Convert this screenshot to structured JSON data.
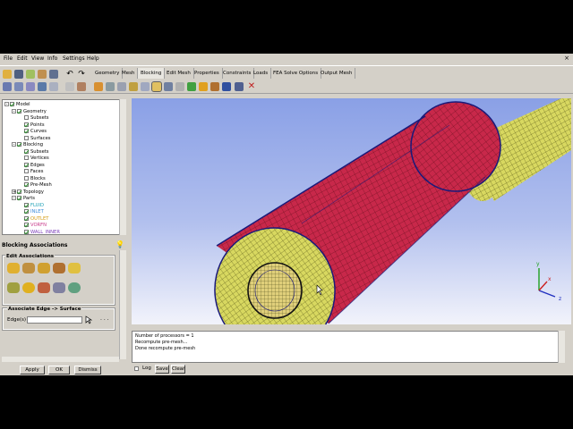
{
  "menu": [
    "File",
    "Edit",
    "View",
    "Info",
    "Settings",
    "Help"
  ],
  "tabs": [
    "Geometry",
    "Mesh",
    "Blocking",
    "Edit Mesh",
    "Properties",
    "Constraints",
    "Loads",
    "FEA Solve Options",
    "Output Mesh"
  ],
  "tree": [
    {
      "label": "Model",
      "indent": 0,
      "expander": "-",
      "checked": true,
      "color": "#000000"
    },
    {
      "label": "Geometry",
      "indent": 1,
      "expander": "-",
      "checked": true,
      "color": "#000000"
    },
    {
      "label": "Subsets",
      "indent": 2,
      "expander": "",
      "checked": false,
      "color": "#000000"
    },
    {
      "label": "Points",
      "indent": 2,
      "expander": "",
      "checked": true,
      "color": "#000000"
    },
    {
      "label": "Curves",
      "indent": 2,
      "expander": "",
      "checked": true,
      "color": "#000000"
    },
    {
      "label": "Surfaces",
      "indent": 2,
      "expander": "",
      "checked": false,
      "color": "#000000"
    },
    {
      "label": "Blocking",
      "indent": 1,
      "expander": "-",
      "checked": true,
      "color": "#000000"
    },
    {
      "label": "Subsets",
      "indent": 2,
      "expander": "",
      "checked": true,
      "color": "#000000"
    },
    {
      "label": "Vertices",
      "indent": 2,
      "expander": "",
      "checked": false,
      "color": "#000000"
    },
    {
      "label": "Edges",
      "indent": 2,
      "expander": "",
      "checked": true,
      "color": "#000000"
    },
    {
      "label": "Faces",
      "indent": 2,
      "expander": "",
      "checked": false,
      "color": "#000000"
    },
    {
      "label": "Blocks",
      "indent": 2,
      "expander": "",
      "checked": false,
      "color": "#000000"
    },
    {
      "label": "Pre-Mesh",
      "indent": 2,
      "expander": "",
      "checked": true,
      "color": "#000000"
    },
    {
      "label": "Topology",
      "indent": 1,
      "expander": "+",
      "checked": true,
      "color": "#000000"
    },
    {
      "label": "Parts",
      "indent": 1,
      "expander": "-",
      "checked": true,
      "color": "#000000"
    },
    {
      "label": "FLUID",
      "indent": 2,
      "expander": "",
      "checked": true,
      "color": "#1a9fb5"
    },
    {
      "label": "INLET",
      "indent": 2,
      "expander": "",
      "checked": true,
      "color": "#3a8ad8"
    },
    {
      "label": "OUTLET",
      "indent": 2,
      "expander": "",
      "checked": true,
      "color": "#d49a10"
    },
    {
      "label": "VORFN",
      "indent": 2,
      "expander": "",
      "checked": true,
      "color": "#c83a8a"
    },
    {
      "label": "WALL_INNER",
      "indent": 2,
      "expander": "",
      "checked": true,
      "color": "#7a3ab8"
    }
  ],
  "panel": {
    "title": "Blocking Associations",
    "edit_group": "Edit Associations",
    "assoc_group": "Associate Edge -> Surface",
    "edges_label": "Edge(s)",
    "edges_value": "",
    "more": ". . .",
    "buttons": {
      "apply": "Apply",
      "ok": "OK",
      "dismiss": "Dismiss"
    }
  },
  "messages": [
    "Number of processors = 1",
    "Recompute pre-mesh...",
    "Done recompute pre-mesh"
  ],
  "log": {
    "label": "Log",
    "save": "Save",
    "clear": "Clear"
  },
  "axes": {
    "x": "x",
    "y": "y",
    "z": "z"
  },
  "colors": {
    "cylinder_large": "#c8284a",
    "cylinder_small": "#d8d860",
    "hub": "#e0cf7a",
    "edge_curves": "#1a1a7a",
    "axis_x": "#cc2020",
    "axis_y": "#20a020",
    "axis_z": "#2030c0"
  }
}
